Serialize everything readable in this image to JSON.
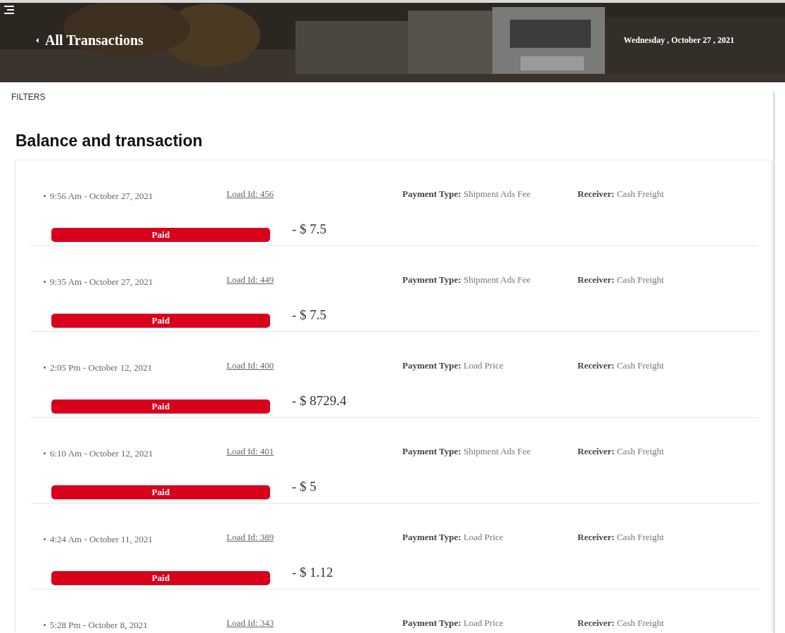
{
  "header": {
    "title": "All Transactions",
    "date": "Wednesday , October 27 , 2021"
  },
  "filters": "FILTERS",
  "section_title": "Balance and transaction",
  "transactions": [
    {
      "time": "9:56 Am - October 27, 2021",
      "load_id": "Load Id: 456",
      "payment_type": "**Payment Type:** Shipment Ads Fee",
      "receiver": "**Receiver:** Cash Freight",
      "status": "Paid",
      "amount": "- $ 7.5"
    },
    {
      "time": "9:35 Am - October 27, 2021",
      "load_id": "Load Id: 449",
      "payment_type": "**Payment Type:** Shipment Ads Fee",
      "receiver": "**Receiver:** Cash Freight",
      "status": "Paid",
      "amount": "- $ 7.5"
    },
    {
      "time": "2:05 Pm - October 12, 2021",
      "load_id": "Load Id: 400",
      "payment_type": "**Payment Type:** Load Price",
      "receiver": "**Receiver:** Cash Freight",
      "status": "Paid",
      "amount": "- $ 8729.4"
    },
    {
      "time": "6:10 Am - October 12, 2021",
      "load_id": "Load Id: 401",
      "payment_type": "**Payment Type:** Shipment Ads Fee",
      "receiver": "**Receiver:** Cash Freight",
      "status": "Paid",
      "amount": "- $ 5"
    },
    {
      "time": "4:24 Am - October 11, 2021",
      "load_id": "Load Id: 389",
      "payment_type": "**Payment Type:** Load Price",
      "receiver": "**Receiver:** Cash Freight",
      "status": "Paid",
      "amount": "- $ 1.12"
    },
    {
      "time": "5:28 Pm - October 8, 2021",
      "load_id": "Load Id: 343",
      "payment_type": "**Payment Type:** Load Price",
      "receiver": "**Receiver:** Cash Freight"
    }
  ]
}
